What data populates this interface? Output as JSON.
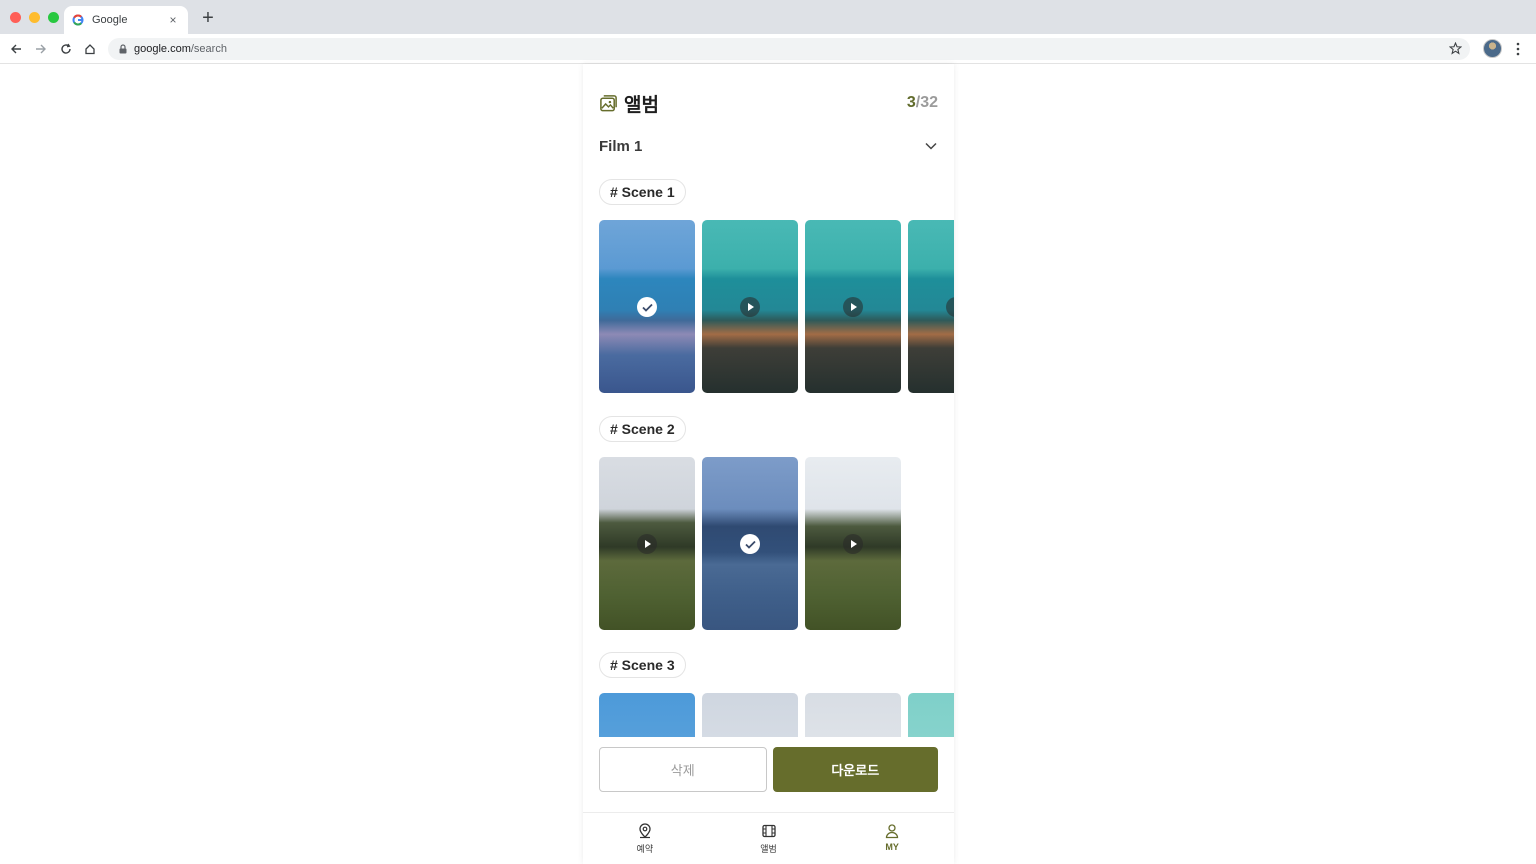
{
  "browser": {
    "tab_title": "Google",
    "tab_close": "×",
    "new_tab": "+",
    "url_domain": "google.com",
    "url_path": "/search"
  },
  "app": {
    "title": "앨범",
    "counter_selected": "3",
    "counter_total": "/32",
    "film_selected": "Film 1",
    "scenes": [
      {
        "label": "# Scene 1",
        "thumbs": [
          {
            "style": "sea-a",
            "badge": "check"
          },
          {
            "style": "sea-b",
            "badge": "play"
          },
          {
            "style": "sea-b",
            "badge": "play"
          },
          {
            "style": "sea-b",
            "badge": "play"
          }
        ]
      },
      {
        "label": "# Scene 2",
        "thumbs": [
          {
            "style": "field-a",
            "badge": "play"
          },
          {
            "style": "field-b",
            "badge": "check"
          },
          {
            "style": "field-c",
            "badge": "play"
          }
        ]
      },
      {
        "label": "# Scene 3",
        "thumbs": [
          {
            "style": "sky-a",
            "badge": "none"
          },
          {
            "style": "sky-b",
            "badge": "none"
          },
          {
            "style": "sky-c",
            "badge": "none"
          },
          {
            "style": "sky-d",
            "badge": "none"
          }
        ]
      }
    ],
    "delete_label": "삭제",
    "download_label": "다운로드",
    "nav": [
      {
        "label": "예약",
        "icon": "map-pin-icon",
        "active": false
      },
      {
        "label": "앨범",
        "icon": "film-icon",
        "active": false
      },
      {
        "label": "MY",
        "icon": "user-icon",
        "active": true
      }
    ]
  },
  "colors": {
    "accent": "#666d2c",
    "counter_accent": "#616b2c"
  }
}
